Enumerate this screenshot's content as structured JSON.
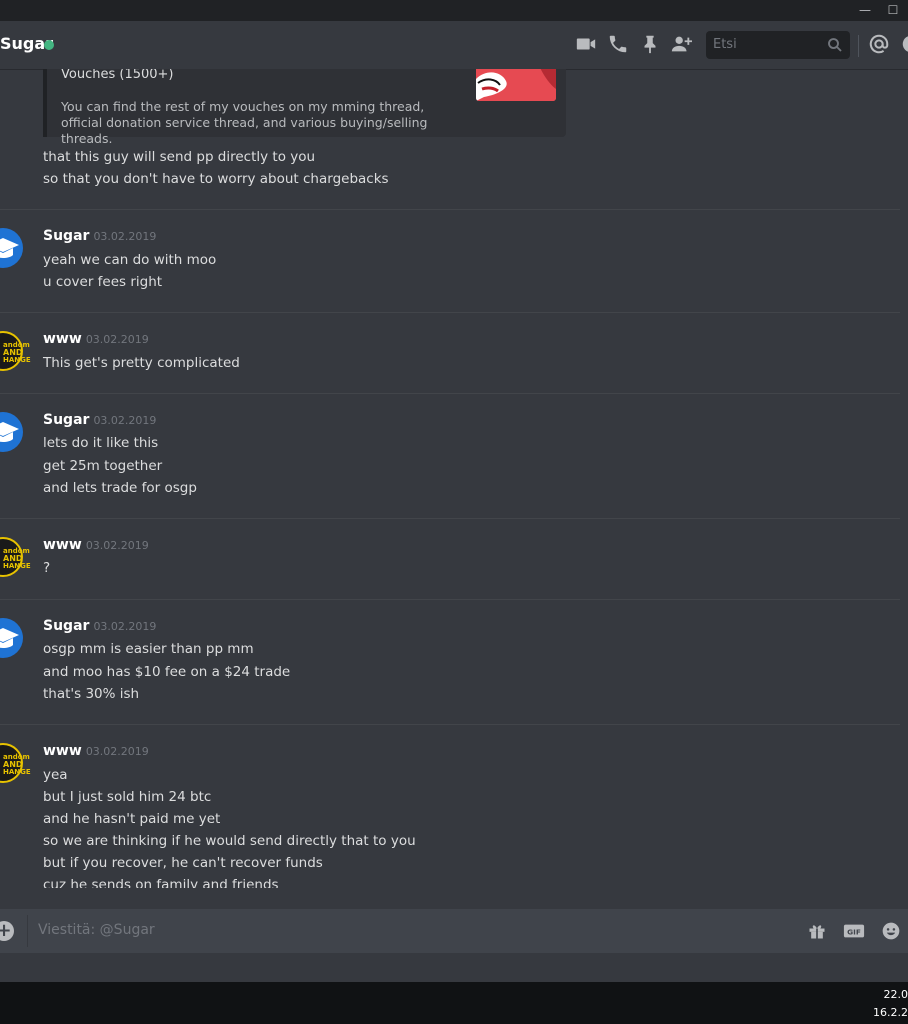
{
  "window": {
    "minimize_glyph": "—",
    "maximize_glyph": "☐"
  },
  "header": {
    "name": "Sugar",
    "search_placeholder": "Etsi",
    "icons": [
      "video-icon",
      "phone-icon",
      "pin-icon",
      "add-friend-icon",
      "search-icon",
      "mention-icon"
    ]
  },
  "embed": {
    "title": "Vouches (1500+)",
    "description": "You can find the rest of my vouches on my mming thread, official donation service thread, and various buying/selling threads."
  },
  "messages": [
    {
      "continued": true,
      "lines": [
        "that this guy will send pp directly to you",
        "so that you don't have to worry about chargebacks"
      ]
    },
    {
      "author": "Sugar",
      "time": "03.02.2019",
      "avatar": "sugar",
      "lines": [
        "yeah we can do with moo",
        "u cover fees right"
      ]
    },
    {
      "author": "www",
      "time": "03.02.2019",
      "avatar": "www",
      "lines": [
        "This get's pretty complicated"
      ]
    },
    {
      "author": "Sugar",
      "time": "03.02.2019",
      "avatar": "sugar",
      "lines": [
        "lets do it like this",
        "get 25m together",
        "and lets trade for osgp"
      ]
    },
    {
      "author": "www",
      "time": "03.02.2019",
      "avatar": "www",
      "lines": [
        "?"
      ]
    },
    {
      "author": "Sugar",
      "time": "03.02.2019",
      "avatar": "sugar",
      "lines": [
        "osgp mm is easier than pp mm",
        "and moo has $10 fee on a $24 trade",
        "that's 30% ish"
      ]
    },
    {
      "author": "www",
      "time": "03.02.2019",
      "avatar": "www",
      "lines": [
        "yea",
        "but I just sold him 24 btc",
        "and he hasn't paid me yet",
        "so we are thinking if he would send directly that to you",
        "but if you recover, he can't recover funds",
        "cuz he sends on family and friends"
      ]
    }
  ],
  "www_avatar_text": [
    "andom",
    "AND",
    "HANGE"
  ],
  "input": {
    "placeholder": "Viestitä: @Sugar",
    "plus_glyph": "+"
  },
  "taskbar": {
    "time": "22.0",
    "date": "16.2.2"
  },
  "colors": {
    "background": "#36393f",
    "online": "#43b581",
    "sugar_avatar": "#1f73d4",
    "www_avatar_ring": "#e7c200"
  }
}
